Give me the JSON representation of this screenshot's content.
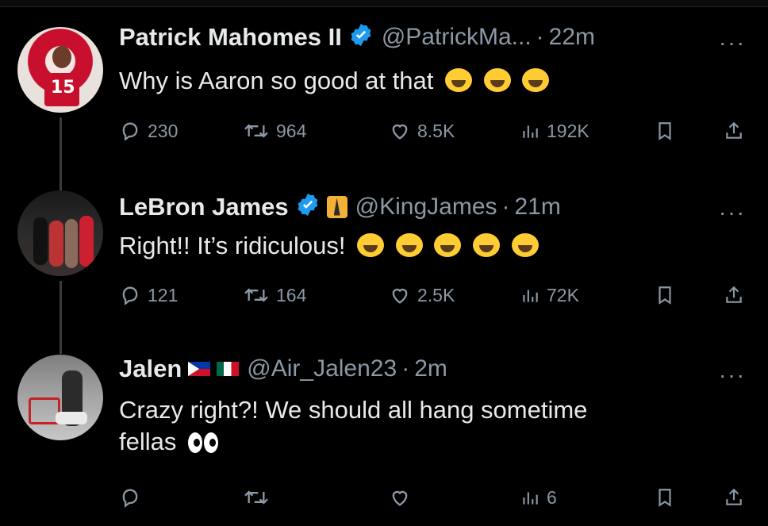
{
  "tweets": [
    {
      "name": "Patrick Mahomes II",
      "handle": "@PatrickMa...",
      "time": "22m",
      "text": "Why is Aaron so good at that",
      "emoji": [
        "face-with-tears-of-joy",
        "face-with-tears-of-joy",
        "face-with-tears-of-joy"
      ],
      "replies": "230",
      "retweets": "964",
      "likes": "8.5K",
      "views": "192K",
      "avatar_number": "15"
    },
    {
      "name": "LeBron James",
      "handle": "@KingJames",
      "time": "21m",
      "text": "Right!! It’s ridiculous!",
      "emoji": [
        "rolling-on-the-floor-laughing",
        "rolling-on-the-floor-laughing",
        "rolling-on-the-floor-laughing",
        "rolling-on-the-floor-laughing",
        "rolling-on-the-floor-laughing"
      ],
      "replies": "121",
      "retweets": "164",
      "likes": "2.5K",
      "views": "72K"
    },
    {
      "name": "Jalen",
      "handle": "@Air_Jalen23",
      "time": "2m",
      "text_line1": "Crazy right?! We should all hang sometime",
      "text_line2": "fellas",
      "emoji": [
        "eyes"
      ],
      "replies": "",
      "retweets": "",
      "likes": "",
      "views": "6"
    }
  ],
  "ui": {
    "separator": "·",
    "more": "···"
  },
  "colors": {
    "background": "#000000",
    "text": "#e7e9ea",
    "secondary": "#8b98a5",
    "verified": "#1d9bf0"
  },
  "icons": [
    "reply-icon",
    "retweet-icon",
    "like-icon",
    "views-icon",
    "bookmark-icon",
    "share-icon",
    "verified-badge-icon",
    "more-icon"
  ]
}
